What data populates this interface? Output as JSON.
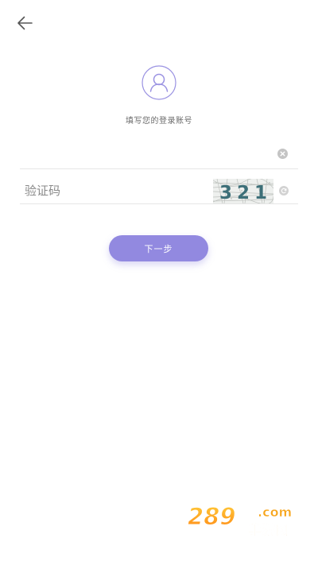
{
  "header": {
    "back_icon": "arrow-left-icon"
  },
  "avatar": {
    "icon": "user-icon",
    "color": "#9289e0"
  },
  "prompt": {
    "text": "填写您的登录账号"
  },
  "account": {
    "value": "",
    "placeholder": "",
    "clear_icon": "clear-circle-icon"
  },
  "captcha": {
    "placeholder": "验证码",
    "value": "",
    "image_text": "3 2 1",
    "refresh_icon": "refresh-icon"
  },
  "next_button": {
    "label": "下一步",
    "color": "#9289e0"
  },
  "watermark": {
    "domain": "289",
    "suffix": ".com",
    "caption": "手游网"
  }
}
